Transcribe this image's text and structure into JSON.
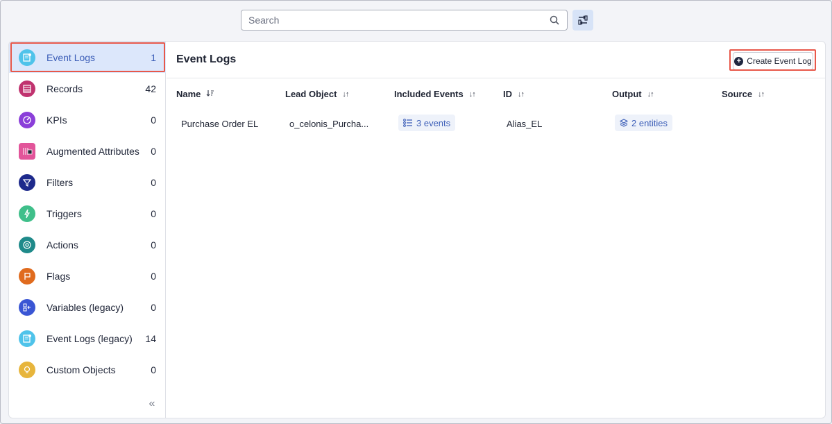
{
  "search": {
    "placeholder": "Search"
  },
  "sidebar": {
    "items": [
      {
        "label": "Event Logs",
        "count": "1",
        "icon": "event-logs-icon",
        "color": "#4fc3ea"
      },
      {
        "label": "Records",
        "count": "42",
        "icon": "records-icon",
        "color": "#c0336f"
      },
      {
        "label": "KPIs",
        "count": "0",
        "icon": "kpi-gauge-icon",
        "color": "#8b3fd9"
      },
      {
        "label": "Augmented Attributes",
        "count": "0",
        "icon": "augmented-attributes-icon",
        "color": "#e2559a"
      },
      {
        "label": "Filters",
        "count": "0",
        "icon": "filter-icon",
        "color": "#1e2a8c"
      },
      {
        "label": "Triggers",
        "count": "0",
        "icon": "trigger-icon",
        "color": "#3fbf8a"
      },
      {
        "label": "Actions",
        "count": "0",
        "icon": "actions-icon",
        "color": "#1f8a8a"
      },
      {
        "label": "Flags",
        "count": "0",
        "icon": "flag-icon",
        "color": "#e06b1e"
      },
      {
        "label": "Variables (legacy)",
        "count": "0",
        "icon": "variables-icon",
        "color": "#3a56d4"
      },
      {
        "label": "Event Logs (legacy)",
        "count": "14",
        "icon": "event-logs-legacy-icon",
        "color": "#4fc3ea"
      },
      {
        "label": "Custom Objects",
        "count": "0",
        "icon": "lightbulb-icon",
        "color": "#e7b53c"
      }
    ]
  },
  "main": {
    "title": "Event Logs",
    "create_label": "Create Event Log",
    "columns": [
      "Name",
      "Lead Object",
      "Included Events",
      "ID",
      "Output",
      "Source"
    ],
    "rows": [
      {
        "name": "Purchase Order EL",
        "lead_object": "o_celonis_Purcha...",
        "included_events": "3 events",
        "id": "Alias_EL",
        "output": "2 entities",
        "source": ""
      }
    ]
  },
  "colors": {
    "accent": "#3d5fb8",
    "active_bg": "#dce7fb",
    "highlight": "#e8584a"
  }
}
